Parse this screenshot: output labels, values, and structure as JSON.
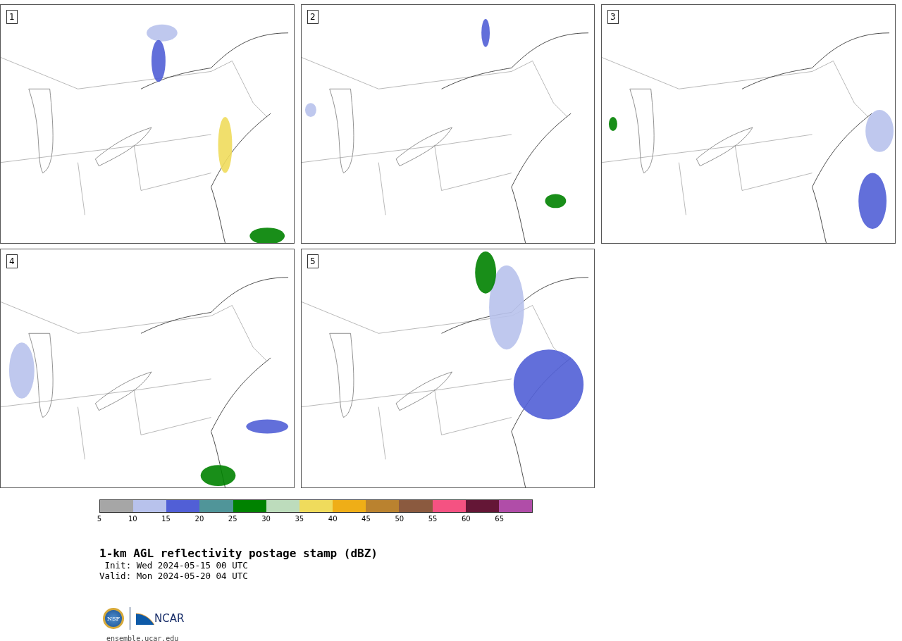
{
  "panels": [
    {
      "label": "1"
    },
    {
      "label": "2"
    },
    {
      "label": "3"
    },
    {
      "label": "4"
    },
    {
      "label": "5"
    }
  ],
  "colorbar": {
    "segments": [
      {
        "color": "#a6a6a6"
      },
      {
        "color": "#b8c2ec"
      },
      {
        "color": "#515fd6"
      },
      {
        "color": "#509599"
      },
      {
        "color": "#008200"
      },
      {
        "color": "#bddcbc"
      },
      {
        "color": "#efdb5c"
      },
      {
        "color": "#efae17"
      },
      {
        "color": "#ba822f"
      },
      {
        "color": "#8b5a3f"
      },
      {
        "color": "#f55282"
      },
      {
        "color": "#641636"
      },
      {
        "color": "#b04da8"
      }
    ],
    "ticks": [
      "5",
      "10",
      "15",
      "20",
      "25",
      "30",
      "35",
      "40",
      "45",
      "50",
      "55",
      "60",
      "65"
    ]
  },
  "title": "1-km AGL reflectivity postage stamp (dBZ)",
  "init": " Init: Wed 2024-05-15 00 UTC",
  "valid": "Valid: Mon 2024-05-20 04 UTC",
  "logos": {
    "nsf": "NSF",
    "ncar": "NCAR"
  },
  "url": "ensemble.ucar.edu"
}
